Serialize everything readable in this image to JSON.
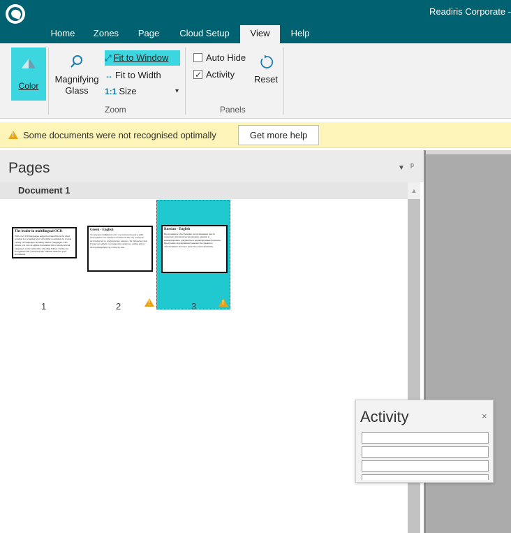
{
  "window": {
    "title": "Readiris Corporate -"
  },
  "tabs": [
    "Home",
    "Zones",
    "Page",
    "Cloud Setup",
    "View",
    "Help"
  ],
  "active_tab": "View",
  "ribbon": {
    "color_label": "Color",
    "magnifying_label_1": "Magnifying",
    "magnifying_label_2": "Glass",
    "fit_window_label": "Fit to Window",
    "fit_width_label": "Fit to Width",
    "size_glyph": "1:1",
    "size_label": "Size",
    "zoom_group": "Zoom",
    "auto_hide_label": "Auto Hide",
    "auto_hide_checked": false,
    "activity_label": "Activity",
    "activity_checked": true,
    "reset_label": "Reset",
    "panels_group": "Panels"
  },
  "notice": {
    "message": "Some documents were not recognised optimally",
    "help_button": "Get more help"
  },
  "pages": {
    "title": "Pages",
    "document_label": "Document 1",
    "thumbnails": [
      {
        "number": "1",
        "warning": false,
        "selected": false,
        "title": "The leader in multilingual OCR",
        "body": "With over 130 languages supported, Readiris is the ideal solution for scanning and converting documents in a wide variety of languages. Reading Mixed Languages. This means you can recognize documents that contain several languages at the same time. Reading Tables. Tables are recognized and converted into editable tables in your documents."
      },
      {
        "number": "2",
        "warning": true,
        "selected": false,
        "title": "Greek - English",
        "body": "Το έγγραφο διαβάζεται από τον αναγνώστη και η κάθε λεπτομέρεια του κειμένου αναλύεται και στη συνέχεια μετατρέπεται σε επεξεργάσιμο κείμενο. Τα δεδομένα είναι έτοιμα για χρήση σε εφαρμογές γραφείου, καθώς και σε άλλες εφαρμογές της επιλογής σας."
      },
      {
        "number": "3",
        "warning": true,
        "selected": true,
        "title": "Russian - English",
        "body": "Программное обеспечение распознавания текста позволяет автоматически вводить данные и конвертировать документы в редактируемые форматы. Программа поддерживает множество языков и обеспечивает высокое качество распознавания."
      }
    ]
  },
  "activity_panel": {
    "title": "Activity",
    "close": "×",
    "rows": [
      "",
      "",
      "",
      ""
    ]
  }
}
